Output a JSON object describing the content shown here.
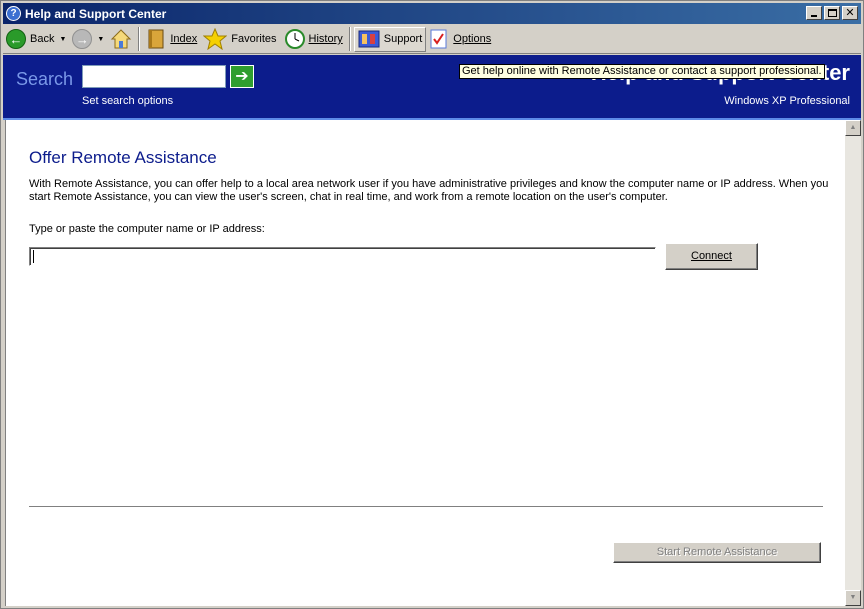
{
  "window": {
    "title": "Help and Support Center",
    "title_icon": "?"
  },
  "toolbar": {
    "back_label": "Back",
    "index_label": "Index",
    "favorites_label": "Favorites",
    "history_label": "History",
    "support_label": "Support",
    "options_label": "Options"
  },
  "header": {
    "search_label": "Search",
    "search_value": "",
    "go_glyph": "➔",
    "search_options": "Set search options",
    "brand_title": "Help and Support Center",
    "brand_subtitle": "Windows XP Professional",
    "tooltip": "Get help online with Remote Assistance or contact a support professional."
  },
  "main": {
    "title": "Offer Remote Assistance",
    "description": "With Remote Assistance, you can offer help to a local area network user if you have administrative privileges and know the computer name or IP address. When you start Remote Assistance, you can view the user's screen, chat in real time, and work from a remote location on the user's computer.",
    "field_label": "Type or paste the computer name or IP address:",
    "ip_value": "",
    "connect_label": "Connect",
    "start_label": "Start Remote Assistance"
  },
  "colors": {
    "header_bg": "#0c1c8c",
    "title_bar": "#0a246a",
    "page_title": "#0c1c8c"
  }
}
